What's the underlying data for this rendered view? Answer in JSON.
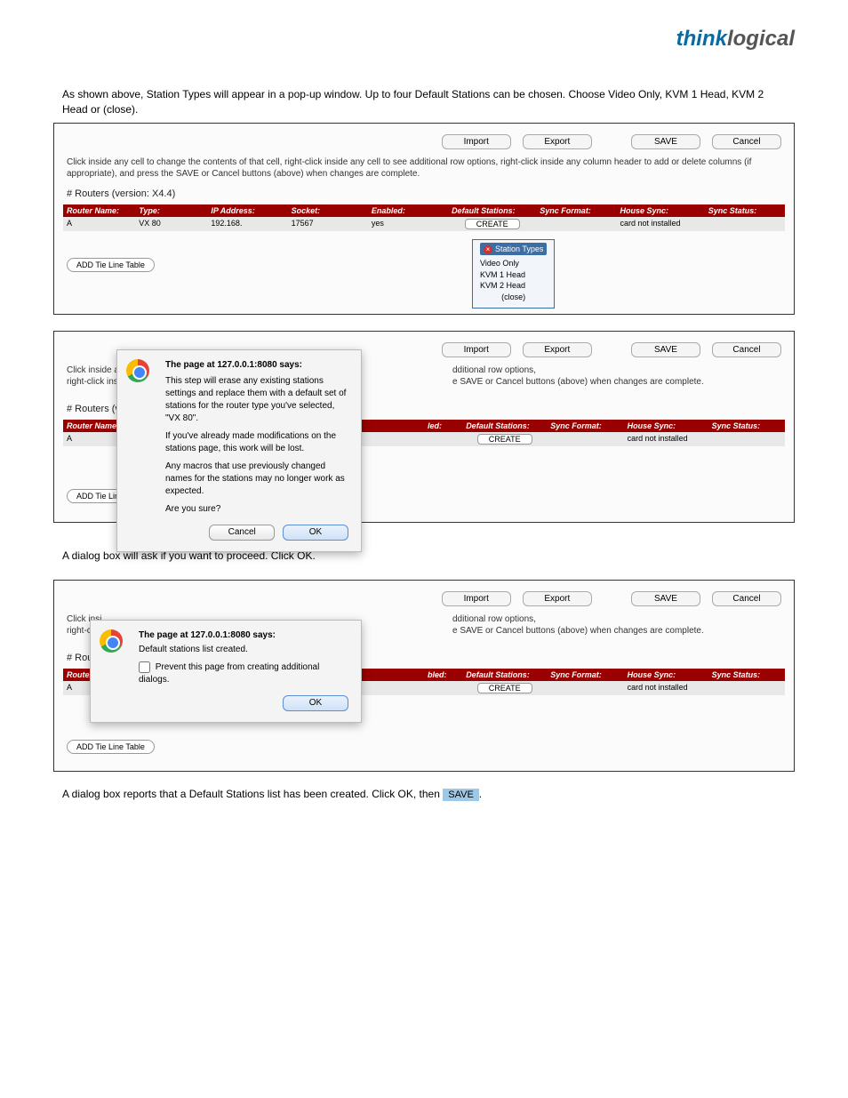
{
  "brand": {
    "part1": "think",
    "part2": "logical"
  },
  "lead": "As shown above, Station Types will appear in a pop-up window. Up to four Default Stations can be chosen. Choose Video Only, KVM 1 Head, KVM 2 Head or (close).",
  "buttons": {
    "import": "Import",
    "export": "Export",
    "save": "SAVE",
    "cancel": "Cancel",
    "create": "CREATE",
    "addtlt": "ADD Tie Line Table",
    "ok": "OK"
  },
  "tip_full": "Click inside any cell to change the contents of that cell, right-click inside any cell to see additional row options, right-click inside any column header to add or delete columns (if appropriate), and press the SAVE or Cancel buttons (above) when changes are complete.",
  "tip_partial_left": "Click inside any ce\nright-click inside a",
  "tip_right_a": "dditional row options,",
  "tip_right_b": "e SAVE or Cancel buttons (above) when changes are complete.",
  "tip3_left": "Click insi\nright-clic",
  "subheading": "# Routers (version: X4.4)",
  "subheading_short": "# Routers (vers",
  "subheading_shorter": "# Route",
  "cols": {
    "name": "Router Name:",
    "type": "Type:",
    "ip": "IP Address:",
    "socket": "Socket:",
    "enabled": "Enabled:",
    "defstations": "Default Stations:",
    "syncfmt": "Sync Format:",
    "housesync": "House Sync:",
    "syncstatus": "Sync Status:"
  },
  "cols_partial": {
    "name_short": "Router I",
    "enabled_short": "led:",
    "enabled_mid": "bled:"
  },
  "row": {
    "name": "A",
    "type": "VX 80",
    "ip": "192.168.",
    "socket": "17567",
    "enabled": "yes",
    "housesync": "card not installed"
  },
  "popup": {
    "title": "Station Types",
    "opt1": "Video Only",
    "opt2": "KVM 1 Head",
    "opt3": "KVM 2 Head",
    "close": "(close)"
  },
  "dialog1": {
    "title": "The page at 127.0.0.1:8080 says:",
    "p1": "This step will erase any existing stations settings and replace them with a default set of stations for the router type you've selected, \"VX 80\".",
    "p2": "If you've already made modifications on the stations page, this work will be lost.",
    "p3": "Any macros that use previously changed names for the stations may no longer work as expected.",
    "p4": "Are you sure?"
  },
  "caption2": "A dialog box will ask if you want to proceed. Click OK.",
  "dialog2": {
    "title": "The page at 127.0.0.1:8080 says:",
    "msg": "Default stations list created.",
    "checkbox": "Prevent this page from creating additional dialogs."
  },
  "caption3_a": "A dialog box reports that a Default Stations list has been created. Click OK, then",
  "caption3_b": "."
}
